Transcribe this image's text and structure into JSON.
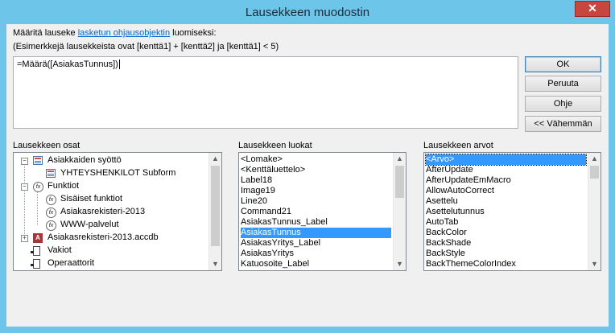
{
  "window": {
    "title": "Lausekkeen muodostin",
    "close_glyph": "✕"
  },
  "instruction": {
    "before_link": "Määritä lauseke ",
    "link": "lasketun ohjausobjektin",
    "after_link": " luomiseksi:",
    "example": "(Esimerkkejä lausekkeista ovat [kenttä1] + [kenttä2] ja [kenttä1] < 5)"
  },
  "expression": {
    "value": "=Määrä([AsiakasTunnus])"
  },
  "buttons": {
    "ok": "OK",
    "cancel": "Peruuta",
    "help": "Ohje",
    "less": "<< Vähemmän"
  },
  "elements_panel": {
    "label": "Lausekkeen osat",
    "items": [
      {
        "label": "Asiakkaiden syöttö",
        "icon": "form-icon",
        "expander": "−"
      },
      {
        "label": "YHTEYSHENKILOT Subform",
        "icon": "form-icon"
      },
      {
        "label": "Funktiot",
        "icon": "function-icon",
        "expander": "−"
      },
      {
        "label": "Sisäiset funktiot",
        "icon": "function-icon"
      },
      {
        "label": "Asiakasrekisteri-2013",
        "icon": "function-icon"
      },
      {
        "label": "WWW-palvelut",
        "icon": "function-icon"
      },
      {
        "label": "Asiakasrekisteri-2013.accdb",
        "icon": "database-icon",
        "expander": "+"
      },
      {
        "label": "Vakiot",
        "icon": "constant-icon"
      },
      {
        "label": "Operaattorit",
        "icon": "operator-icon"
      }
    ]
  },
  "categories_panel": {
    "label": "Lausekkeen luokat",
    "items": [
      "<Lomake>",
      "<Kenttäluettelo>",
      "Label18",
      "Image19",
      "Line20",
      "Command21",
      "AsiakasTunnus_Label",
      "AsiakasTunnus",
      "AsiakasYritys_Label",
      "AsiakasYritys",
      "Katuosoite_Label"
    ],
    "selected": 7
  },
  "values_panel": {
    "label": "Lausekkeen arvot",
    "items": [
      "<Arvo>",
      "AfterUpdate",
      "AfterUpdateEmMacro",
      "AllowAutoCorrect",
      "Asettelu",
      "Asettelutunnus",
      "AutoTab",
      "BackColor",
      "BackShade",
      "BackStyle",
      "BackThemeColorIndex"
    ],
    "selected": 0
  },
  "colors": {
    "titlebar": "#6dc6e9",
    "selection": "#3399ff",
    "link": "#0066cc",
    "close": "#c7463e"
  }
}
